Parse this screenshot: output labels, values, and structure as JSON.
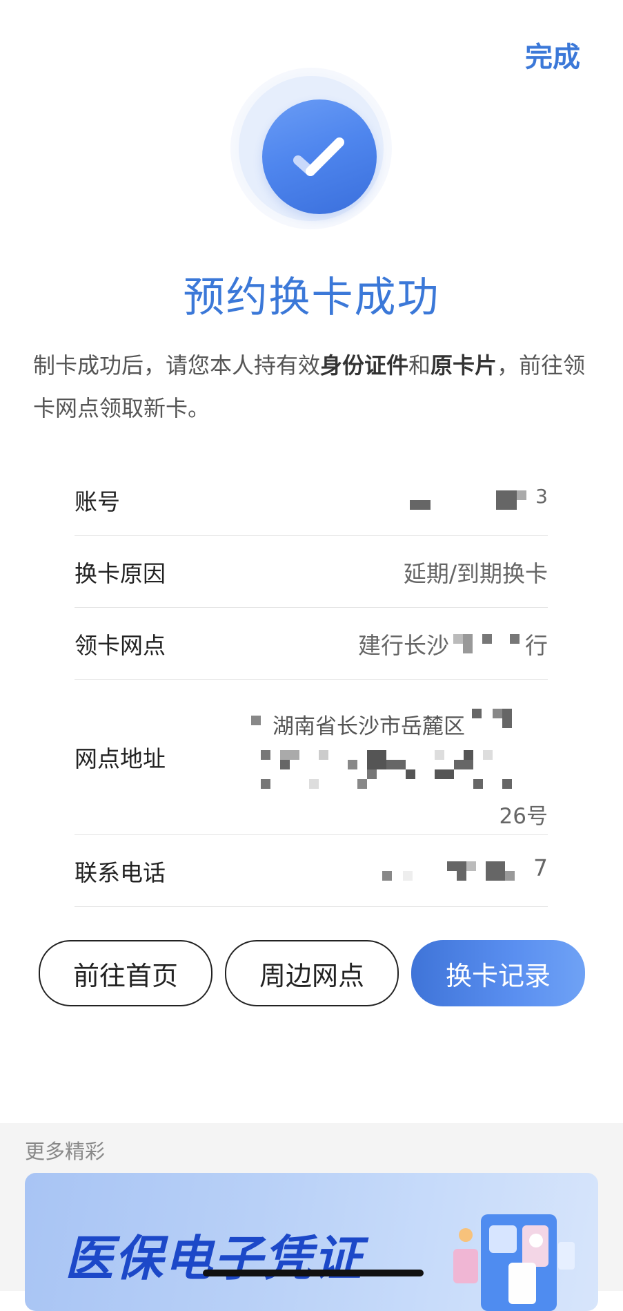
{
  "header": {
    "done_label": "完成"
  },
  "result": {
    "title": "预约换卡成功"
  },
  "notice": {
    "part1": "制卡成功后，请您本人持有效",
    "bold1": "身份证件",
    "part2": "和",
    "bold2": "原卡片",
    "part3": "，前往领卡网点领取新卡。"
  },
  "info": {
    "account": {
      "label": "账号",
      "value_tail": "3"
    },
    "reason": {
      "label": "换卡原因",
      "value": "延期/到期换卡"
    },
    "branch": {
      "label": "领卡网点",
      "value_head": "建行长沙",
      "value_tail": "行"
    },
    "address": {
      "label": "网点地址",
      "line1": "湖南省长沙市岳麓区",
      "line3": "26号"
    },
    "phone": {
      "label": "联系电话",
      "value_tail": "7"
    }
  },
  "buttons": {
    "home": "前往首页",
    "nearby": "周边网点",
    "records": "换卡记录"
  },
  "more": {
    "label": "更多精彩",
    "banner_text": "医保电子凭证"
  }
}
